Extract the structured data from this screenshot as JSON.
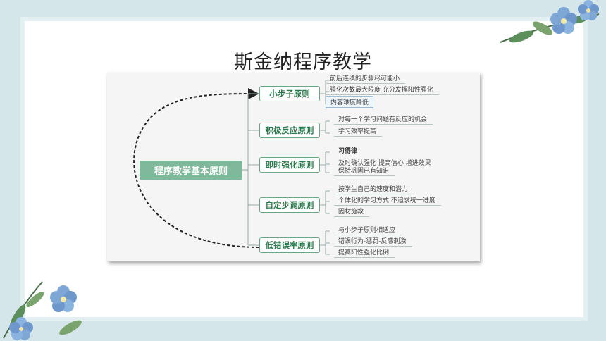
{
  "slide": {
    "title": "斯金纳程序教学"
  },
  "mindmap": {
    "center": "程序教学基本原则",
    "branches": [
      {
        "label": "小步子原则",
        "leaves": [
          "前后连续的步骤尽可能小",
          "强化次数最大限度 充分发挥阳性强化",
          "内容难度降低"
        ]
      },
      {
        "label": "积极反应原则",
        "leaves": [
          "对每一个学习问题有反应的机会",
          "学习效率提高"
        ]
      },
      {
        "label": "即时强化原则",
        "leaves": [
          "习得律",
          "及时确认强化 提高信心 增进效果",
          "保持巩固已有知识"
        ]
      },
      {
        "label": "自定步调原则",
        "leaves": [
          "按学生自己的速度和潜力",
          "个体化的学习方式 不追求统一进度",
          "因材施教"
        ]
      },
      {
        "label": "低错误率原则",
        "leaves": [
          "与小步子原则相适应",
          "错误行为-惩罚-反感刺激",
          "提高阳性强化比例"
        ]
      }
    ]
  },
  "colors": {
    "accent": "#7fb89a",
    "branch_text": "#2d7a4f",
    "background": "#d5e6ea"
  }
}
